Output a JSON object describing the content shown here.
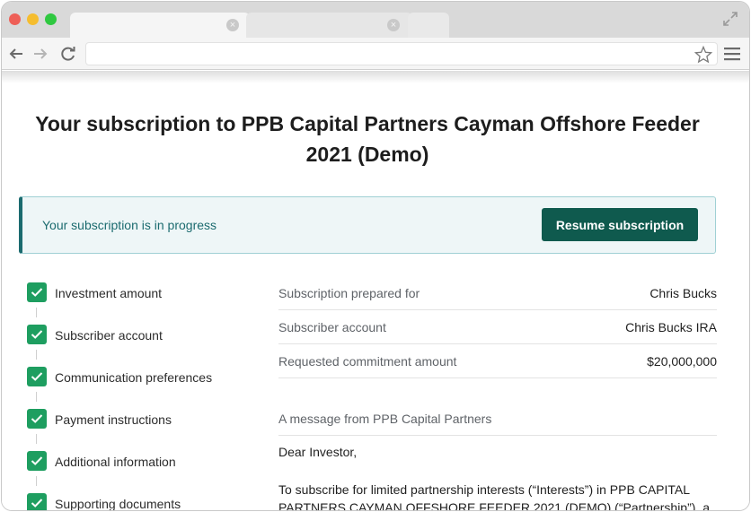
{
  "browser": {
    "url": ""
  },
  "page": {
    "title": "Your subscription to PPB Capital Partners Cayman Offshore Feeder 2021 (Demo)"
  },
  "banner": {
    "status_text": "Your subscription is in progress",
    "resume_label": "Resume subscription"
  },
  "steps": [
    {
      "label": "Investment amount",
      "complete": true
    },
    {
      "label": "Subscriber account",
      "complete": true
    },
    {
      "label": "Communication preferences",
      "complete": true
    },
    {
      "label": "Payment instructions",
      "complete": true
    },
    {
      "label": "Additional information",
      "complete": true
    },
    {
      "label": "Supporting documents",
      "complete": true
    }
  ],
  "details": [
    {
      "label": "Subscription prepared for",
      "value": "Chris Bucks"
    },
    {
      "label": "Subscriber account",
      "value": "Chris Bucks IRA"
    },
    {
      "label": "Requested commitment amount",
      "value": "$20,000,000"
    }
  ],
  "message": {
    "heading": "A message from PPB Capital Partners",
    "greeting": "Dear Investor,",
    "body": "To subscribe for limited partnership interests (“Interests”) in PPB CAPITAL PARTNERS CAYMAN OFFSHORE FEEDER 2021 (DEMO) (“Partnership”), a"
  },
  "colors": {
    "accent": "#0f5a4e",
    "banner_border": "#1b6b6f",
    "check": "#1e9e60"
  }
}
